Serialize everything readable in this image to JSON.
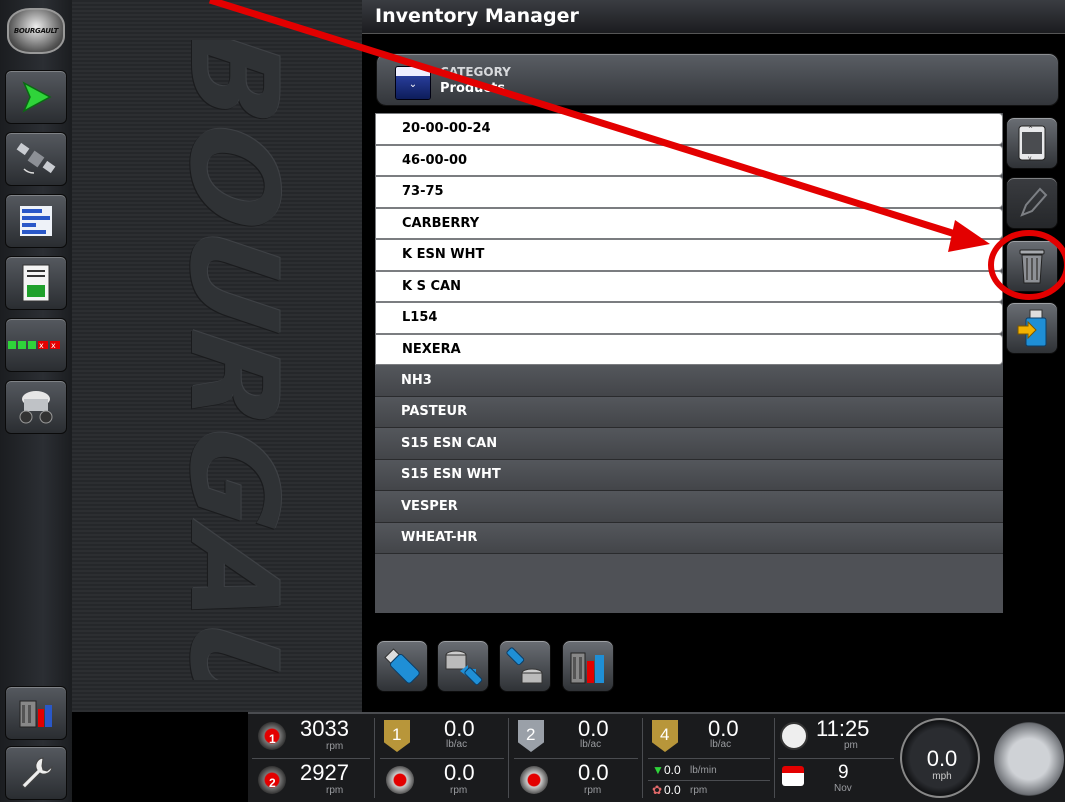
{
  "app": {
    "title": "Inventory Manager",
    "logo_text": "BOURGAULT",
    "brand_watermark": "BOURGAULT"
  },
  "category": {
    "label": "CATEGORY",
    "value": "Products"
  },
  "products": [
    {
      "name": "20-00-00-24",
      "state": "active"
    },
    {
      "name": "46-00-00",
      "state": "active"
    },
    {
      "name": "73-75",
      "state": "active"
    },
    {
      "name": "CARBERRY",
      "state": "active"
    },
    {
      "name": "K ESN WHT",
      "state": "active"
    },
    {
      "name": "K S CAN",
      "state": "active"
    },
    {
      "name": "L154",
      "state": "active"
    },
    {
      "name": "NEXERA",
      "state": "active"
    },
    {
      "name": "NH3",
      "state": "inactive"
    },
    {
      "name": "PASTEUR",
      "state": "inactive"
    },
    {
      "name": "S15 ESN CAN",
      "state": "inactive"
    },
    {
      "name": "S15 ESN WHT",
      "state": "inactive"
    },
    {
      "name": "VESPER",
      "state": "inactive"
    },
    {
      "name": "WHEAT-HR",
      "state": "inactive"
    }
  ],
  "status_bar": {
    "fan1": {
      "number": "1",
      "value": "3033",
      "unit": "rpm"
    },
    "fan2": {
      "number": "2",
      "value": "2927",
      "unit": "rpm"
    },
    "tank1": {
      "number": "1",
      "rate": "0.0",
      "rate_unit": "lb/ac",
      "meter": "0.0",
      "meter_unit": "rpm"
    },
    "tank2": {
      "number": "2",
      "rate": "0.0",
      "rate_unit": "lb/ac",
      "meter": "0.0",
      "meter_unit": "rpm"
    },
    "tank4": {
      "number": "4",
      "rate": "0.0",
      "rate_unit": "lb/ac",
      "flow": "0.0",
      "flow_unit": "lb/min",
      "pump": "0.0",
      "pump_unit": "rpm"
    },
    "clock": {
      "time": "11:25",
      "ampm": "pm"
    },
    "date": {
      "day": "9",
      "month": "Nov"
    },
    "speed": {
      "value": "0.0",
      "unit": "mph"
    }
  },
  "colors": {
    "accent_red": "#e30000",
    "tank_gold": "#b8963a",
    "tank_silver": "#9aa0a8",
    "category_blue": "#1a2f80"
  },
  "icons": {
    "rail": [
      "logo-badge",
      "guidance-arrow-icon",
      "satellite-icon",
      "rate-bars-icon",
      "report-icon",
      "section-status-icon",
      "seeder-icon",
      "inventory-manager-icon",
      "wrench-icon"
    ],
    "side": [
      "scroll-list-icon",
      "pencil-icon",
      "trash-icon",
      "usb-import-icon"
    ],
    "bottom": [
      "usb-drive-icon",
      "database-to-usb-icon",
      "usb-to-database-icon",
      "inventory-tools-icon"
    ]
  }
}
